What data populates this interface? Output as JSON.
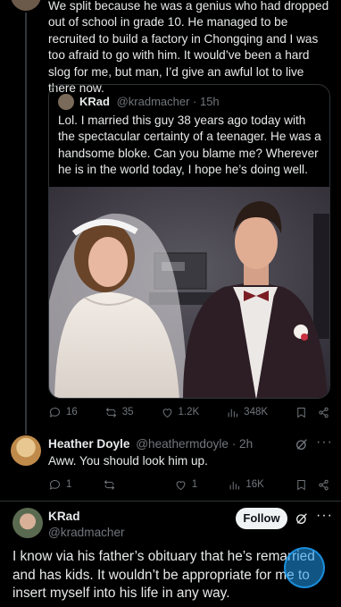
{
  "top_post": {
    "text": "We split because he was a genius who had dropped out of school in grade 10. He managed to be recruited to build a factory in Chongqing and I was too afraid to go with him. It would’ve been a hard slog for me, but man, I’d give an awful lot to live there now."
  },
  "quoted_post": {
    "name": "KRad",
    "handle": "@kradmacher · 15h",
    "text": "Lol. I married this guy 38 years ago today with the spectacular certainty of a teenager. He was a handsome bloke. Can you blame me? Wherever he is in the world today, I hope he’s doing well."
  },
  "top_actions": {
    "replies": "16",
    "reposts": "35",
    "likes": "1.2K",
    "views": "348K"
  },
  "reply": {
    "name": "Heather Doyle",
    "handle": "@heathermdoyle · 2h",
    "text": "Aww.  You should look him up.",
    "actions": {
      "replies": "1",
      "reposts": "",
      "likes": "1",
      "views": "16K"
    }
  },
  "main_post": {
    "name": "KRad",
    "handle": "@kradmacher",
    "follow_label": "Follow",
    "text": "I know via his father’s obituary that he’s remarried and has kids. It wouldn’t be appropriate for me to insert myself into his life in any way."
  },
  "colors": {
    "background": "#000000",
    "text": "#e7e9ea",
    "muted": "#71767b",
    "accent": "#1d9bf0",
    "border": "#2f3336"
  },
  "icons": [
    "reply-icon",
    "repost-icon",
    "like-icon",
    "views-icon",
    "bookmark-icon",
    "share-icon",
    "grok-icon",
    "more-icon"
  ]
}
